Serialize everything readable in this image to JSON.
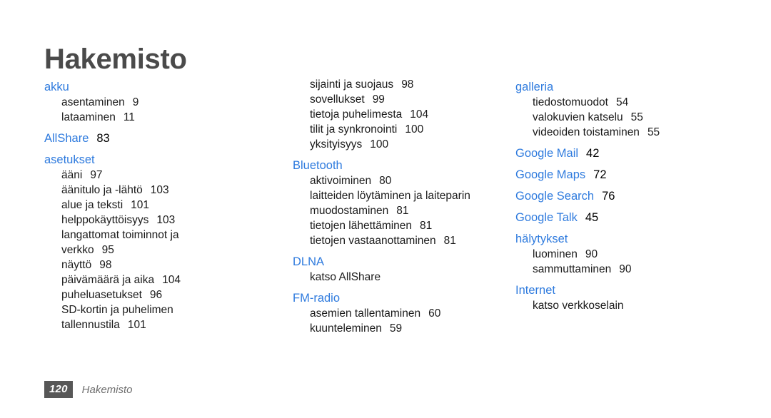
{
  "document": {
    "title": "Hakemisto",
    "accent_color": "#2f7bde",
    "title_color": "#4a4a4a",
    "folio_bg_color": "#575757",
    "background_color": "#ffffff"
  },
  "columns": [
    {
      "id": "column-1",
      "groups": [
        {
          "heading": "akku",
          "heading_page": "",
          "entries": [
            {
              "label": "asentaminen",
              "page": "9"
            },
            {
              "label": "lataaminen",
              "page": "11"
            }
          ]
        },
        {
          "heading": "AllShare",
          "heading_page": "83",
          "entries": []
        },
        {
          "heading": "asetukset",
          "heading_page": "",
          "entries": [
            {
              "label": "ääni",
              "page": "97"
            },
            {
              "label": "äänitulo ja -lähtö",
              "page": "103"
            },
            {
              "label": "alue ja teksti",
              "page": "101"
            },
            {
              "label": "helppokäyttöisyys",
              "page": "103"
            },
            {
              "label": "langattomat toiminnot ja",
              "page": ""
            },
            {
              "label": "verkko",
              "page": "95"
            },
            {
              "label": "näyttö",
              "page": "98"
            },
            {
              "label": "päivämäärä ja aika",
              "page": "104"
            },
            {
              "label": "puheluasetukset",
              "page": "96"
            },
            {
              "label": "SD-kortin ja puhelimen",
              "page": ""
            },
            {
              "label": "tallennustila",
              "page": "101"
            }
          ]
        }
      ]
    },
    {
      "id": "column-2",
      "continued_entries": [
        {
          "label": "sijainti ja suojaus",
          "page": "98"
        },
        {
          "label": "sovellukset",
          "page": "99"
        },
        {
          "label": "tietoja puhelimesta",
          "page": "104"
        },
        {
          "label": "tilit ja synkronointi",
          "page": "100"
        },
        {
          "label": "yksityisyys",
          "page": "100"
        }
      ],
      "groups": [
        {
          "heading": "Bluetooth",
          "heading_page": "",
          "entries": [
            {
              "label": "aktivoiminen",
              "page": "80"
            },
            {
              "label": "laitteiden löytäminen ja laiteparin",
              "page": ""
            },
            {
              "label": "muodostaminen",
              "page": "81"
            },
            {
              "label": "tietojen lähettäminen",
              "page": "81"
            },
            {
              "label": "tietojen vastaanottaminen",
              "page": "81"
            }
          ]
        },
        {
          "heading": "DLNA",
          "heading_page": "",
          "entries": [
            {
              "label": "katso AllShare",
              "page": ""
            }
          ]
        },
        {
          "heading": "FM-radio",
          "heading_page": "",
          "entries": [
            {
              "label": "asemien tallentaminen",
              "page": "60"
            },
            {
              "label": "kuunteleminen",
              "page": "59"
            }
          ]
        }
      ]
    },
    {
      "id": "column-3",
      "continued_entries": [],
      "groups": [
        {
          "heading": "galleria",
          "heading_page": "",
          "entries": [
            {
              "label": "tiedostomuodot",
              "page": "54"
            },
            {
              "label": "valokuvien katselu",
              "page": "55"
            },
            {
              "label": "videoiden toistaminen",
              "page": "55"
            }
          ]
        },
        {
          "heading": "Google Mail",
          "heading_page": "42",
          "entries": []
        },
        {
          "heading": "Google Maps",
          "heading_page": "72",
          "entries": []
        },
        {
          "heading": "Google Search",
          "heading_page": "76",
          "entries": []
        },
        {
          "heading": "Google Talk",
          "heading_page": "45",
          "entries": []
        },
        {
          "heading": "hälytykset",
          "heading_page": "",
          "entries": [
            {
              "label": "luominen",
              "page": "90"
            },
            {
              "label": "sammuttaminen",
              "page": "90"
            }
          ]
        },
        {
          "heading": "Internet",
          "heading_page": "",
          "entries": [
            {
              "label": "katso verkkoselain",
              "page": ""
            }
          ]
        }
      ]
    }
  ],
  "footer": {
    "page_number": "120",
    "section_label": "Hakemisto"
  }
}
